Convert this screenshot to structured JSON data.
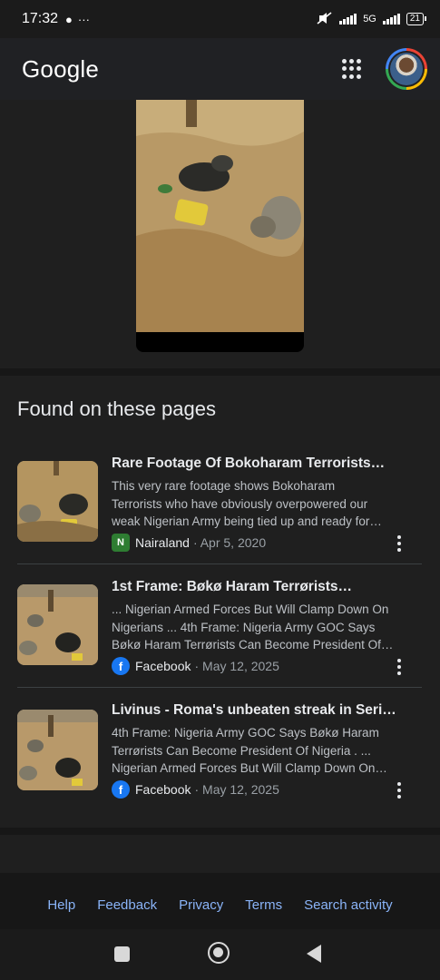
{
  "status_bar": {
    "time": "17:32",
    "network": "5G",
    "battery": "21"
  },
  "header": {
    "logo": "Google"
  },
  "found": {
    "title": "Found on these pages",
    "results": [
      {
        "title": "Rare Footage Of Bokoharam Terrorists…",
        "snippet": [
          "This very rare footage shows Bokoharam",
          "Terrorists who have obviously overpowered our",
          "weak Nigerian Army being tied up and ready for…"
        ],
        "source": "Nairaland",
        "date": "· Apr 5, 2020",
        "favicon": "nairaland-icon"
      },
      {
        "title": "1st Frame: Bøkø Haram Terrørists…",
        "snippet": [
          "... Nigerian Armed Forces But Will Clamp Down On",
          "Nigerians ... 4th Frame: Nigeria Army GOC Says",
          "Bøkø Haram Terrørists Can Become President Of…"
        ],
        "source": "Facebook",
        "date": "· May 12, 2025",
        "favicon": "facebook-icon"
      },
      {
        "title": "Livinus - Roma's unbeaten streak in Seri…",
        "snippet": [
          "4th Frame: Nigeria Army GOC Says Bøkø Haram",
          "Terrørists Can Become President Of Nigeria . ...",
          "Nigerian Armed Forces But Will Clamp Down On…"
        ],
        "source": "Facebook",
        "date": "· May 12, 2025",
        "favicon": "facebook-icon"
      }
    ]
  },
  "footer": {
    "links": [
      "Help",
      "Feedback",
      "Privacy",
      "Terms",
      "Search activity"
    ]
  }
}
